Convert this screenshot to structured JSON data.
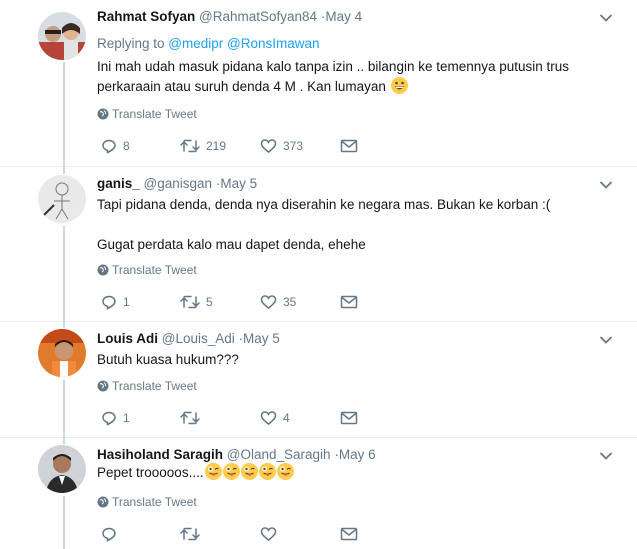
{
  "tweets": [
    {
      "name": "Rahmat Sofyan",
      "handle": "@RahmatSofyan84",
      "dot": "·",
      "time": "May 4",
      "replying_prefix": "Replying to ",
      "replying_to": [
        "@medipr",
        "@RonsImawan"
      ],
      "text_lines": [
        "Ini mah udah masuk pidana kalo tanpa izin .. bilangin ke temennya putusin trus",
        "perkaraain atau suruh denda 4 M . Kan lumayan"
      ],
      "emoji": "grinning-face-emoji",
      "translate": "Translate Tweet",
      "replies": "8",
      "retweets": "219",
      "likes": "373"
    },
    {
      "name": "ganis_",
      "handle": "@ganisgan",
      "dot": "·",
      "time": "May 5",
      "text_lines": [
        "Tapi pidana denda, denda nya diserahin ke negara mas. Bukan ke korban :(",
        "Gugat perdata kalo mau dapet denda, ehehe"
      ],
      "translate": "Translate Tweet",
      "replies": "1",
      "retweets": "5",
      "likes": "35"
    },
    {
      "name": "Louis Adi",
      "handle": "@Louis_Adi",
      "dot": "·",
      "time": "May 5",
      "text_lines": [
        "Butuh kuasa hukum???"
      ],
      "translate": "Translate Tweet",
      "replies": "1",
      "retweets": "",
      "likes": "4"
    },
    {
      "name": "Hasiholand Saragih",
      "handle": "@Oland_Saragih",
      "dot": "·",
      "time": "May 6",
      "text_lines": [
        "Pepet trooooos...."
      ],
      "emoji": "winking-face-with-tongue-emoji",
      "emoji_count": 5,
      "translate": "Translate Tweet",
      "replies": "",
      "retweets": "",
      "likes": ""
    }
  ],
  "colors": {
    "text": "#14171a",
    "muted": "#657786",
    "link": "#1da1f2",
    "border": "#e6ecf0",
    "thread_line": "#ccd6dd",
    "emoji": "#ffcc4d"
  }
}
